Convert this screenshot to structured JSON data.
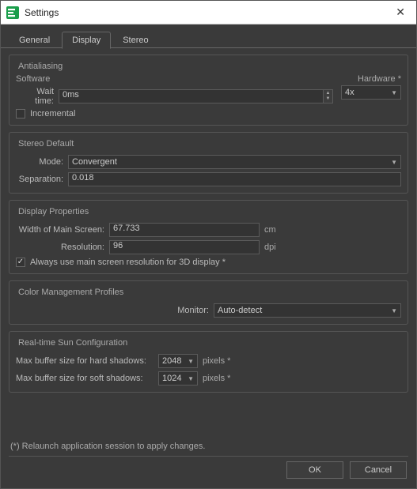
{
  "window": {
    "title": "Settings"
  },
  "tabs": {
    "general": "General",
    "display": "Display",
    "stereo": "Stereo"
  },
  "antialiasing": {
    "group": "Antialiasing",
    "software_label": "Software",
    "hardware_label": "Hardware *",
    "wait_time_label": "Wait time:",
    "wait_time_value": "0ms",
    "incremental_label": "Incremental",
    "hardware_value": "4x"
  },
  "stereo": {
    "group": "Stereo Default",
    "mode_label": "Mode:",
    "mode_value": "Convergent",
    "separation_label": "Separation:",
    "separation_value": "0.018"
  },
  "display_props": {
    "group": "Display Properties",
    "width_label": "Width of Main Screen:",
    "width_value": "67.733",
    "width_unit": "cm",
    "resolution_label": "Resolution:",
    "resolution_value": "96",
    "resolution_unit": "dpi",
    "always_use_label": "Always use main screen resolution for 3D display *"
  },
  "color": {
    "group": "Color Management Profiles",
    "monitor_label": "Monitor:",
    "monitor_value": "Auto-detect"
  },
  "sun": {
    "group": "Real-time Sun Configuration",
    "hard_label": "Max buffer size for hard shadows:",
    "hard_value": "2048",
    "soft_label": "Max buffer size for soft shadows:",
    "soft_value": "1024",
    "unit": "pixels *"
  },
  "footer": {
    "note": "(*) Relaunch application session to apply changes.",
    "ok": "OK",
    "cancel": "Cancel"
  }
}
